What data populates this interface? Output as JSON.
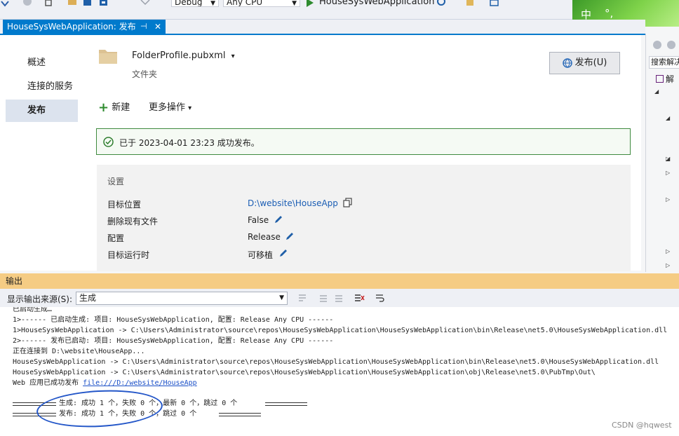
{
  "toolbar": {
    "config": "Debug",
    "platform": "Any CPU",
    "startup_project": "HouseSysWebApplication"
  },
  "ime": {
    "mode": "中",
    "punct": "°,"
  },
  "doctab": {
    "title": "HouseSysWebApplication: 发布",
    "pin_icon": "pin-icon",
    "close": "✕"
  },
  "nav": {
    "overview": "概述",
    "connected_services": "连接的服务",
    "publish": "发布"
  },
  "profile": {
    "name": "FolderProfile.pubxml",
    "dropdown_arrow": "▾",
    "type": "文件夹",
    "publish_button": "发布(U)"
  },
  "commands": {
    "new_plus": "+",
    "new": "新建",
    "more": "更多操作",
    "more_arrow": "▾"
  },
  "status": {
    "message": "已于 2023-04-01 23:23 成功发布。",
    "color": "#3f8a3f"
  },
  "settings": {
    "header": "设置",
    "rows": [
      {
        "label": "目标位置",
        "value": "D:\\website\\HouseApp"
      },
      {
        "label": "删除现有文件",
        "value": "False"
      },
      {
        "label": "配置",
        "value": "Release"
      },
      {
        "label": "目标运行时",
        "value": "可移植"
      }
    ]
  },
  "solution_explorer": {
    "search_placeholder": "搜索解决方案资源管理器",
    "root_label": "解"
  },
  "output": {
    "title": "输出",
    "source_label": "显示输出来源(S):",
    "source_value": "生成",
    "lines": [
      "已启动生成…",
      "1>------ 已启动生成: 项目: HouseSysWebApplication, 配置: Release Any CPU ------",
      "1>HouseSysWebApplication -> C:\\Users\\Administrator\\source\\repos\\HouseSysWebApplication\\HouseSysWebApplication\\bin\\Release\\net5.0\\HouseSysWebApplication.dll",
      "2>------ 发布已启动: 项目: HouseSysWebApplication, 配置: Release Any CPU ------",
      "正在连接到 D:\\website\\HouseApp...",
      "HouseSysWebApplication -> C:\\Users\\Administrator\\source\\repos\\HouseSysWebApplication\\HouseSysWebApplication\\bin\\Release\\net5.0\\HouseSysWebApplication.dll",
      "HouseSysWebApplication -> C:\\Users\\Administrator\\source\\repos\\HouseSysWebApplication\\HouseSysWebApplication\\obj\\Release\\net5.0\\PubTmp\\Out\\"
    ],
    "web_prefix": "Web 应用已成功发布 ",
    "web_link": "file:///D:/website/HouseApp",
    "summary_build": "生成: 成功 1 个，失败 0 个，最新 0 个，跳过 0 个",
    "summary_publish": "发布: 成功 1 个，失败 0 个，跳过 0 个"
  },
  "watermark": "CSDN @hqwest",
  "colors": {
    "accent": "#007acc",
    "output_title": "#f5cc84",
    "link": "#1a5db4",
    "highlight_circle": "#2356c8"
  }
}
